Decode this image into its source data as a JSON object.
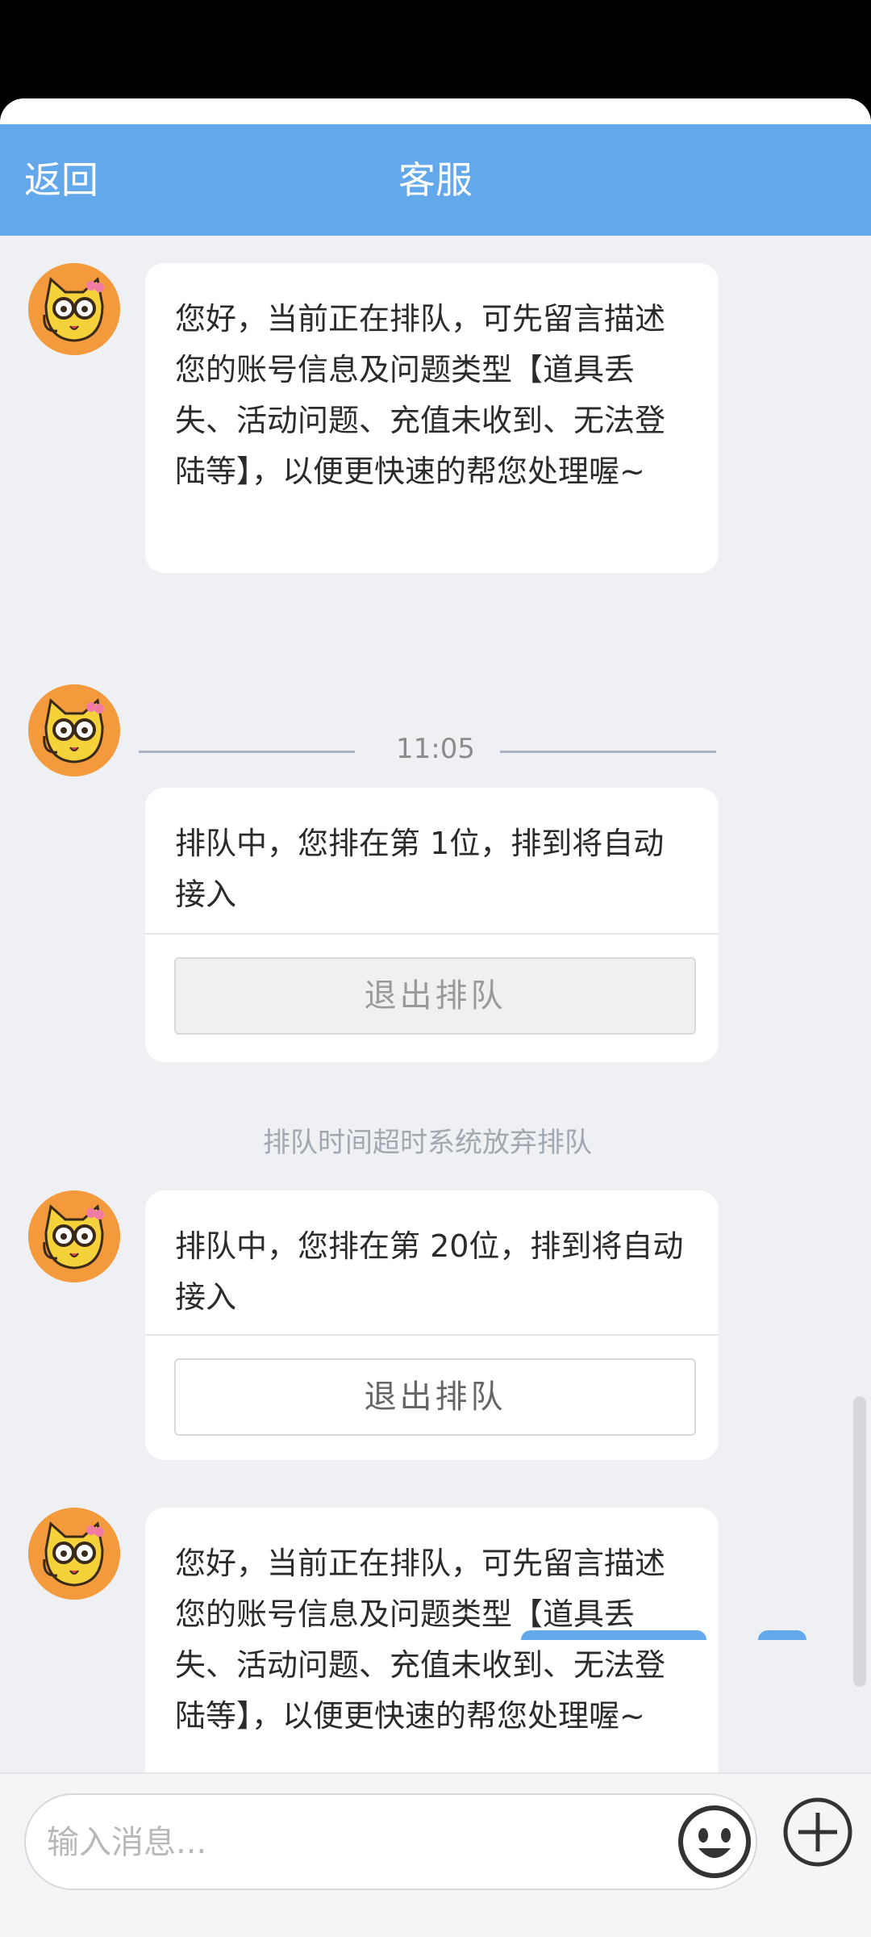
{
  "header": {
    "back_label": "返回",
    "title": "客服"
  },
  "messages": [
    {
      "text": "您好，当前正在排队，可先留言描述您的账号信息及问题类型【道具丢失、活动问题、充值未收到、无法登陆等】，以便更快速的帮您处理喔~"
    },
    {
      "time": "11:05"
    },
    {
      "text": "排队中，您排在第 1位，排到将自动接入",
      "button": "退出排队",
      "button_state": "disabled"
    },
    {
      "system": "排队时间超时系统放弃排队"
    },
    {
      "text": "排队中，您排在第 20位，排到将自动接入",
      "button": "退出排队",
      "button_state": "enabled"
    },
    {
      "text": "您好，当前正在排队，可先留言描述您的账号信息及问题类型【道具丢失、活动问题、充值未收到、无法登陆等】，以便更快速的帮您处理喔~"
    }
  ],
  "input": {
    "placeholder": "输入消息..."
  },
  "icons": {
    "agent_avatar": "cat-agent-avatar-icon",
    "emoji": "smiley-emoji-icon",
    "plus": "plus-circle-icon"
  },
  "colors": {
    "header": "#62a8ea",
    "background": "#eef0f3"
  }
}
